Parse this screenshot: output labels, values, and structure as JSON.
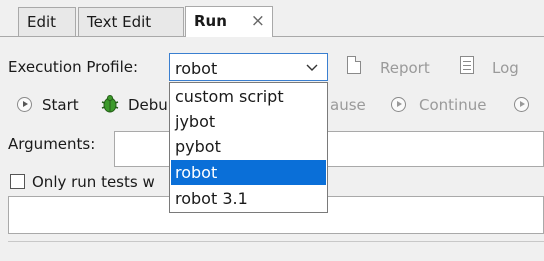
{
  "tabs": [
    {
      "label": "Edit"
    },
    {
      "label": "Text Edit"
    },
    {
      "label": "Run",
      "active": true,
      "close": "×"
    }
  ],
  "profile": {
    "label": "Execution Profile:",
    "value": "robot",
    "report_label": "Report",
    "log_label": "Log"
  },
  "dropdown": {
    "options": [
      "custom script",
      "jybot",
      "pybot",
      "robot",
      "robot 3.1"
    ],
    "selected_index": 3
  },
  "toolbar": {
    "start_label": "Start",
    "debug_label_partial": "Debu",
    "pause_label_partial": "ause",
    "continue_label": "Continue"
  },
  "arguments": {
    "label": "Arguments:"
  },
  "only_run": {
    "label_partial": "Only run tests w",
    "checked": false
  },
  "colors": {
    "selection": "#0a6fd8",
    "combo_border": "#3a7fd0",
    "bug_green": "#3c9a2a"
  },
  "icons": [
    "report-doc-icon",
    "log-doc-icon",
    "start-play-icon",
    "debug-bug-icon",
    "pause-icon",
    "continue-icon",
    "step-icon",
    "chevron-down-icon",
    "close-icon"
  ]
}
